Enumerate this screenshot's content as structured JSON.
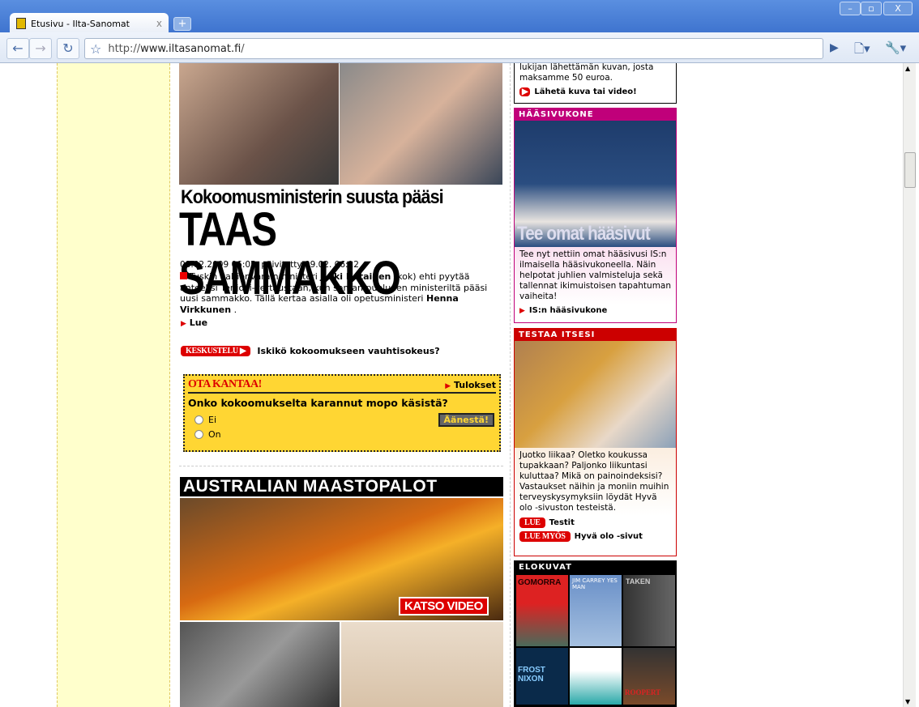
{
  "browser": {
    "tab_title": "Etusivu - Ilta-Sanomat",
    "tab_close": "x",
    "new_tab": "+",
    "url_prefix": "http://",
    "url_host": "www.iltasanomat.fi",
    "url_suffix": "/",
    "minimize": "–",
    "maximize": "▫",
    "close": "X"
  },
  "article": {
    "headline_small": "Kokoomusministerin suusta pääsi",
    "headline_big": "TAAS SAMMAKKO",
    "date": "08.02.2009 06:05, päivitetty 09.02. 06:12",
    "lead_1": "Tuskin valtionvarainministeri ",
    "lead_name1": "Jyrki Katainen",
    "lead_2": " (kok) ehti pyytää anteeksi Terijoki-vertaustaan, kun saman puolueen ministeriltä pääsi uusi sammakko. Tällä kertaa asialla oli opetusministeri ",
    "lead_name2": "Henna Virkkunen",
    "lead_3": " .",
    "read_label": "Lue"
  },
  "discussion": {
    "badge": "KESKUSTELU",
    "title": "Iskikö kokoomukseen vauhtisokeus?"
  },
  "poll": {
    "title": "OTA KANTAA!",
    "results": "Tulokset",
    "question": "Onko kokoomukselta karannut mopo käsistä?",
    "options": [
      "Ei",
      "On"
    ],
    "vote": "Äänestä!"
  },
  "feature": {
    "title": "AUSTRALIAN MAASTOPALOT",
    "video": "KATSO VIDEO"
  },
  "sidebar": {
    "reader": {
      "text": "lukijan lähettämän kuvan, josta maksamme 50 euroa.",
      "link": "Lähetä kuva tai video!"
    },
    "wedding": {
      "header": "HÄÄSIVUKONE",
      "image_caption": "Tee omat hääsivut",
      "text": "Tee nyt nettiin omat hääsivusi IS:n ilmaisella hääsivukoneella. Näin helpotat juhlien valmisteluja sekä tallennat ikimuistoisen tapahtuman vaiheita!",
      "link": "IS:n hääsivukone"
    },
    "test": {
      "header": "TESTAA ITSESI",
      "text": "Juotko liikaa? Oletko koukussa tupakkaan? Paljonko liikuntasi kuluttaa? Mikä on painoindeksisi? Vastaukset näihin ja moniin muihin terveyskysymyksiin löydät Hyvä olo -sivuston testeistä.",
      "badge1": "LUE",
      "link1": "Testit",
      "badge2": "LUE MYÖS",
      "link2": "Hyvä olo -sivut"
    },
    "movies": {
      "header": "ELOKUVAT",
      "posters": [
        "GOMORRA",
        "JIM CARREY YES MAN",
        "TAKEN",
        "FROST NIXON",
        "",
        "ROOPERT"
      ]
    }
  },
  "colors": {
    "red": "#dd0000",
    "poll_yellow": "#ffd633",
    "wedding": "#c0007a"
  }
}
